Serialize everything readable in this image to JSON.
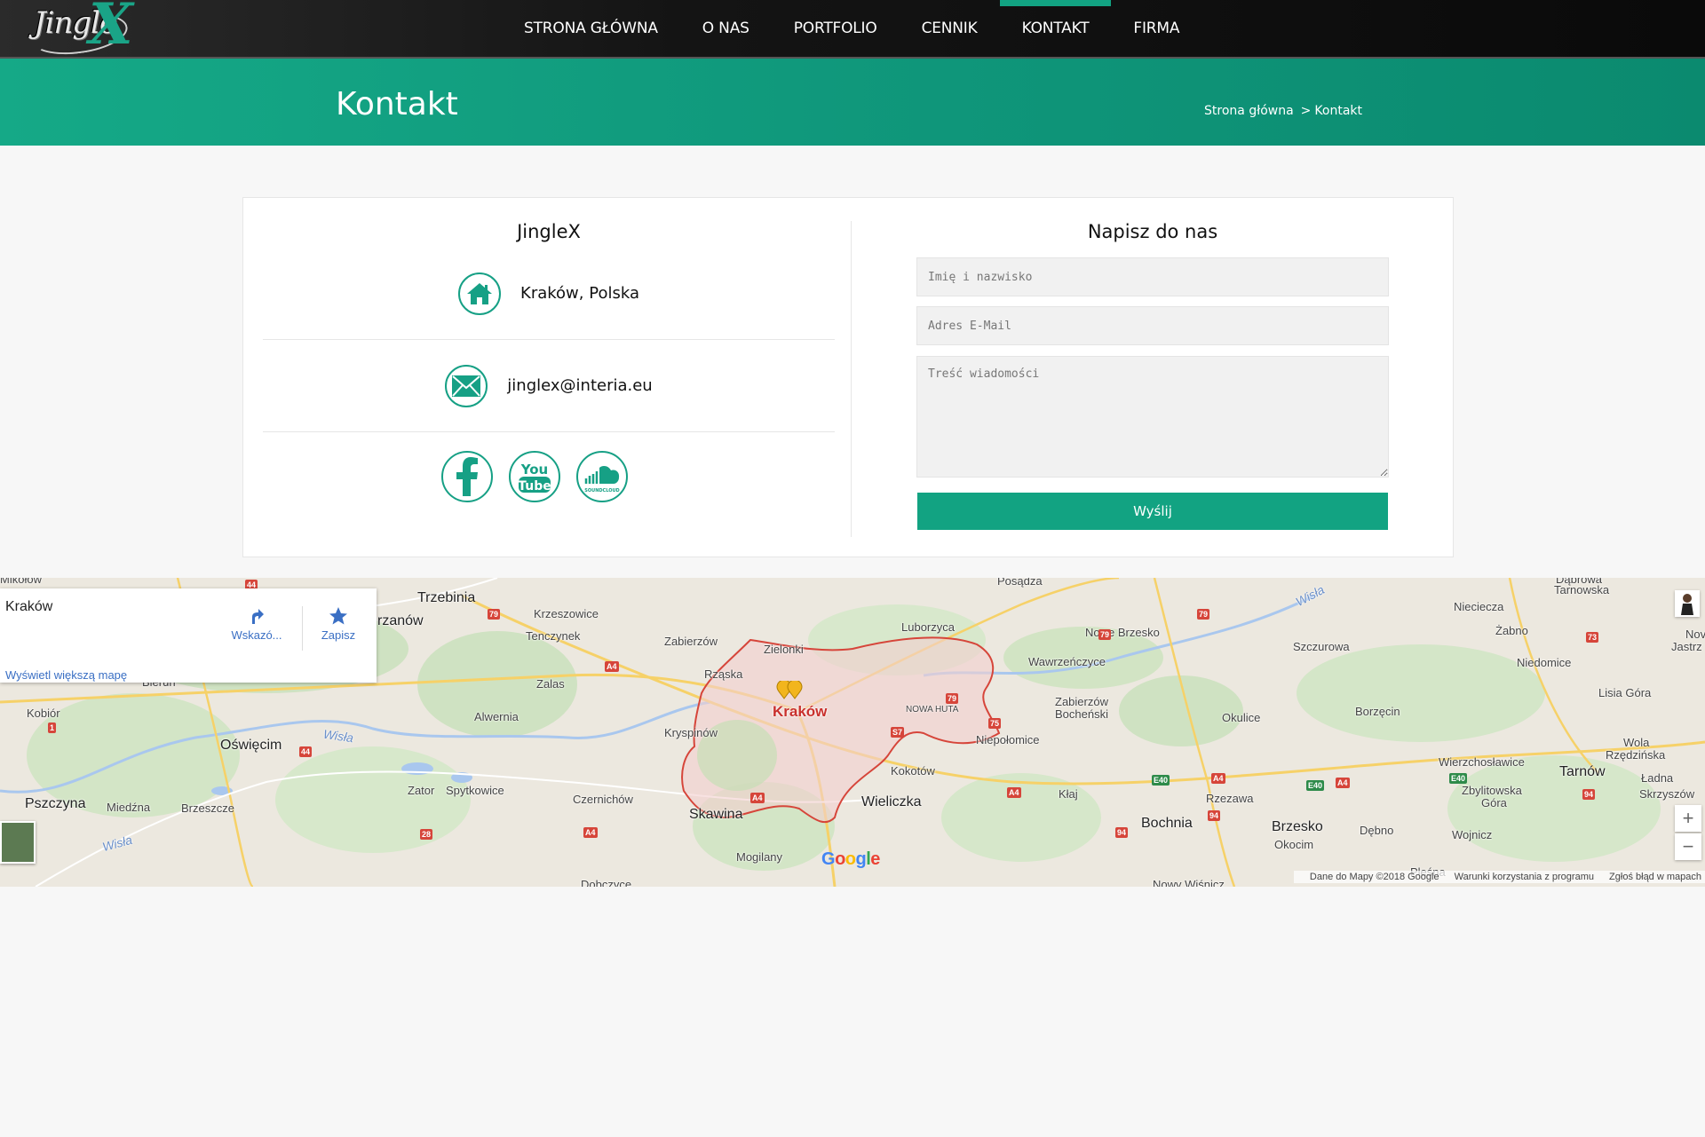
{
  "nav": {
    "logo_text": "Jingle",
    "logo_x": "X",
    "items": [
      {
        "label": "STRONA GŁÓWNA"
      },
      {
        "label": "O NAS"
      },
      {
        "label": "PORTFOLIO"
      },
      {
        "label": "CENNIK"
      },
      {
        "label": "KONTAKT",
        "active": true
      },
      {
        "label": "FIRMA"
      }
    ]
  },
  "banner": {
    "title": "Kontakt",
    "breadcrumb": {
      "home": "Strona główna",
      "separator": ">",
      "current": "Kontakt"
    }
  },
  "contact": {
    "title": "JingleX",
    "address": "Kraków, Polska",
    "email": "jinglex@interia.eu",
    "address_icon": "home-icon",
    "email_icon": "envelope-icon",
    "socials": [
      {
        "name": "facebook-icon"
      },
      {
        "name": "youtube-icon",
        "text1": "You",
        "text2": "Tube"
      },
      {
        "name": "soundcloud-icon",
        "text": "SOUNDCLOUD"
      }
    ]
  },
  "form": {
    "title": "Napisz do nas",
    "name_placeholder": "Imię i nazwisko",
    "email_placeholder": "Adres E-Mail",
    "message_placeholder": "Treść wiadomości",
    "submit_label": "Wyślij"
  },
  "map": {
    "place": "Kraków",
    "directions_label": "Wskazó...",
    "save_label": "Zapisz",
    "bigger_map": "Wyświetl większą mapę",
    "zoom_in": "+",
    "zoom_out": "−",
    "google": "Google",
    "attribution": {
      "data": "Dane do Mapy ©2018 Google",
      "terms": "Warunki korzystania z programu",
      "report": "Zgłoś błąd w mapach"
    },
    "labels": {
      "krakow": "Kraków",
      "trzebinia": "Trzebinia",
      "chrzanow": "rzanów",
      "krzeszowice": "Krzeszowice",
      "tenczynek": "Tenczynek",
      "zabierzow": "Zabierzów",
      "zielonki": "Zielonki",
      "rzaska": "Rząska",
      "zalas": "Zalas",
      "alwernia": "Alwernia",
      "oswiecim": "Oświęcim",
      "kobior": "Kobiór",
      "pszczyna": "Pszczyna",
      "miedzna": "Miedźna",
      "brzeszcze": "Brzeszcze",
      "zator": "Zator",
      "spytkowice": "Spytkowice",
      "czernichow": "Czernichów",
      "kryspinow": "Kryspinów",
      "skawina": "Skawina",
      "mogilany": "Mogilany",
      "wieliczka": "Wieliczka",
      "kokotow": "Kokotów",
      "nowa_huta": "NOWA HUTA",
      "niepolomice": "Niepołomice",
      "luborzyca": "Luborzyca",
      "posadza": "Posądza",
      "nowe_brzesko": "Nowe Brzesko",
      "wawrzenczyce": "Wawrzeńczyce",
      "zabierzow_bochenski_1": "Zabierzów",
      "zabierzow_bochenski_2": "Bocheński",
      "klaj": "Kłaj",
      "okulice": "Okulice",
      "rzezawa": "Rzezawa",
      "bochnia": "Bochnia",
      "szczurowa": "Szczurowa",
      "niecieczą": "Niecieczа",
      "zabno": "Żabno",
      "niedomice": "Niedomice",
      "borzecin": "Borzęcin",
      "brzesko": "Brzesko",
      "okocim": "Okocim",
      "debno": "Dębno",
      "wojnicz": "Wojnicz",
      "wierzchoslawice": "Wierzchosławice",
      "zbylitowska_1": "Zbylitowska",
      "zbylitowska_2": "Góra",
      "tarnow": "Tarnów",
      "lisia_gora": "Lisia Góra",
      "wola_1": "Wola",
      "wola_2": "Rzędzińska",
      "ladna": "Ładna",
      "skrzyszow": "Skrzyszów",
      "tarnowska": "Tarnowska",
      "dabrowa": "Dąbrowa",
      "jastrz_1": "Nov",
      "jastrz_2": "Jastrz",
      "plesna": "Pleśna",
      "nowy_wisnicz": "Nowy Wiśnicz",
      "dobczyce": "Dobczyce",
      "bierun": "Bieruń",
      "mikolow": "Mikołów",
      "wisla_1": "Wisła",
      "wisla_2": "Wisła",
      "wisla_3": "Wisła"
    },
    "roads": {
      "r79a": "79",
      "r79b": "79",
      "r79c": "79",
      "r79d": "79",
      "r44a": "44",
      "r44b": "44",
      "r44c": "44",
      "a4a": "A4",
      "a4b": "A4",
      "a4c": "A4",
      "a4d": "A4",
      "a4e": "A4",
      "a4f": "A4",
      "r1": "1",
      "r28": "28",
      "r94a": "94",
      "r94b": "94",
      "r94c": "94",
      "s7": "S7",
      "r75": "75",
      "r73": "73",
      "e40a": "E40",
      "e40b": "E40",
      "e40c": "E40"
    }
  }
}
